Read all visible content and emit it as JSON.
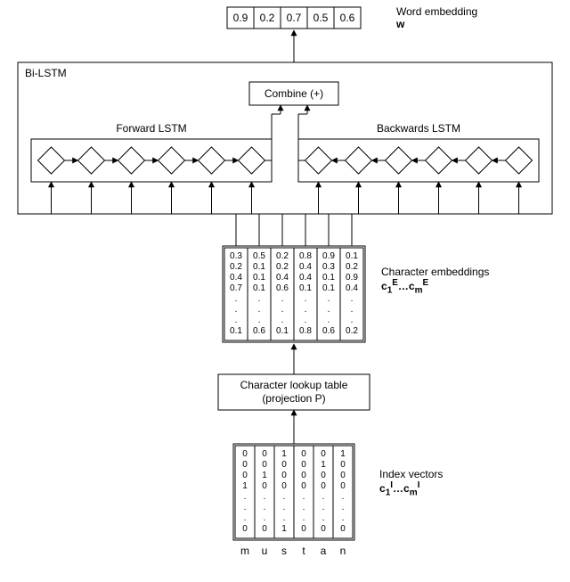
{
  "word_embedding": {
    "values": [
      "0.9",
      "0.2",
      "0.7",
      "0.5",
      "0.6"
    ],
    "label": "Word embedding",
    "symbol": "w"
  },
  "bilstm": {
    "box_label": "Bi-LSTM",
    "forward_label": "Forward LSTM",
    "backward_label": "Backwards LSTM",
    "combine_label": "Combine (+)"
  },
  "char_embeddings": {
    "label": "Character embeddings",
    "symbol_html": "c<sub>1</sub><sup>E</sup>…c<sub>m</sub><sup>E</sup>",
    "columns": [
      [
        "0.3",
        "0.2",
        "0.4",
        "0.7",
        ".",
        ".",
        ".",
        "0.1"
      ],
      [
        "0.5",
        "0.1",
        "0.1",
        "0.1",
        ".",
        ".",
        ".",
        "0.6"
      ],
      [
        "0.2",
        "0.2",
        "0.4",
        "0.6",
        ".",
        ".",
        ".",
        "0.1"
      ],
      [
        "0.8",
        "0.4",
        "0.4",
        "0.1",
        ".",
        ".",
        ".",
        "0.8"
      ],
      [
        "0.9",
        "0.3",
        "0.1",
        "0.1",
        ".",
        ".",
        ".",
        "0.6"
      ],
      [
        "0.1",
        "0.2",
        "0.9",
        "0.4",
        ".",
        ".",
        ".",
        "0.2"
      ]
    ]
  },
  "lookup": {
    "line1": "Character lookup table",
    "line2": "(projection P)"
  },
  "index_vectors": {
    "label": "Index vectors",
    "symbol_html": "c<sub>1</sub><sup>I</sup>…c<sub>m</sub><sup>I</sup>",
    "columns": [
      [
        "0",
        "0",
        "0",
        "1",
        ".",
        ".",
        ".",
        "0"
      ],
      [
        "0",
        "0",
        "1",
        "0",
        ".",
        ".",
        ".",
        "0"
      ],
      [
        "1",
        "0",
        "0",
        "0",
        ".",
        ".",
        ".",
        "1"
      ],
      [
        "0",
        "0",
        "0",
        "0",
        ".",
        ".",
        ".",
        "0"
      ],
      [
        "0",
        "1",
        "0",
        "0",
        ".",
        ".",
        ".",
        "0"
      ],
      [
        "1",
        "0",
        "0",
        "0",
        ".",
        ".",
        ".",
        "0"
      ]
    ],
    "chars": [
      "m",
      "u",
      "s",
      "t",
      "a",
      "n"
    ]
  },
  "chart_data": {
    "type": "diagram",
    "title": "Character-level Bi-LSTM word embedding",
    "input_word": "mustan",
    "input_chars": [
      "m",
      "u",
      "s",
      "t",
      "a",
      "n"
    ],
    "index_vectors_shown_rows": 4,
    "character_embedding_dim_shown": 4,
    "lookup": "projection P",
    "bilstm_cells_per_direction": 6,
    "combine_op": "sum",
    "word_embedding_dim_shown": 5,
    "word_embedding_values": [
      0.9,
      0.2,
      0.7,
      0.5,
      0.6
    ]
  }
}
